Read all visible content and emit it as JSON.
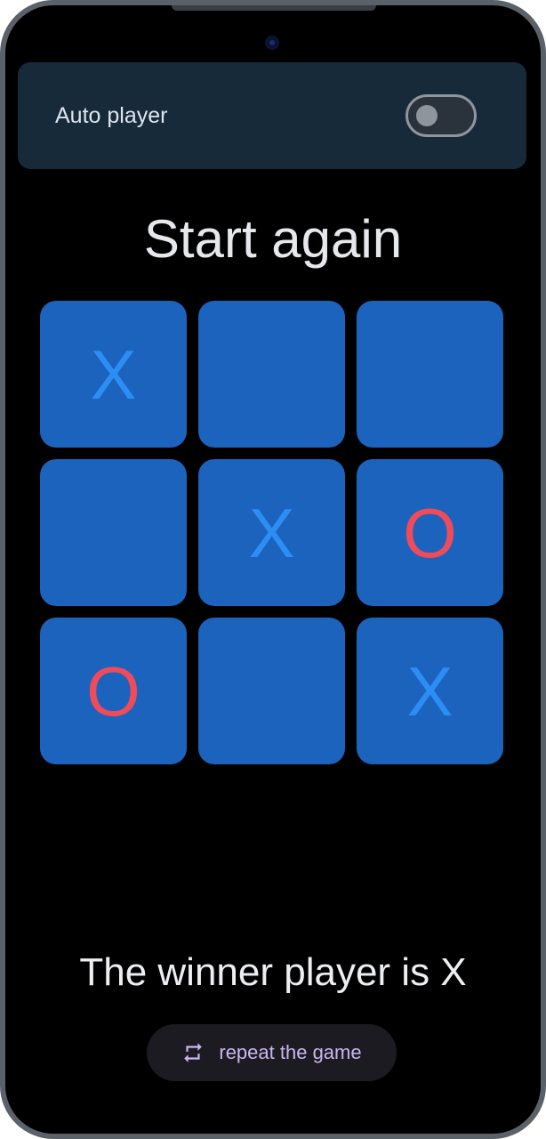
{
  "auto_player": {
    "label": "Auto player",
    "enabled": false
  },
  "title": "Start again",
  "board": {
    "cells": [
      "X",
      "",
      "",
      "",
      "X",
      "O",
      "O",
      "",
      "X"
    ]
  },
  "winner_text": "The winner player is X",
  "repeat_button": {
    "label": "repeat the game",
    "icon": "repeat-icon"
  },
  "colors": {
    "cell_background": "#1b63bd",
    "x_color": "#2c8df4",
    "o_color": "#ef4b5a",
    "panel_background": "#172a3a"
  }
}
